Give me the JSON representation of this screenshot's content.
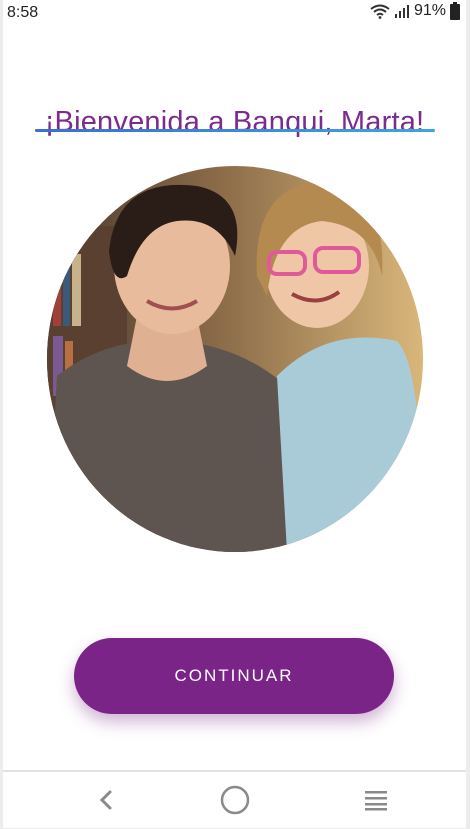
{
  "status_bar": {
    "time": "8:58",
    "battery": "91%",
    "icons": [
      "wifi-icon",
      "signal-icon",
      "battery-icon"
    ]
  },
  "welcome": {
    "text": "¡Bienvenida a Banqui, Marta!",
    "color": "#7b2a8e"
  },
  "photo": {
    "icon": "family-photo",
    "description_icon": "mother-daughter-photo"
  },
  "continue_button": {
    "label": "CONTINUAR",
    "color": "#7a2487"
  },
  "nav_bar": {
    "icons": [
      "back-icon",
      "home-icon",
      "menu-icon"
    ]
  }
}
